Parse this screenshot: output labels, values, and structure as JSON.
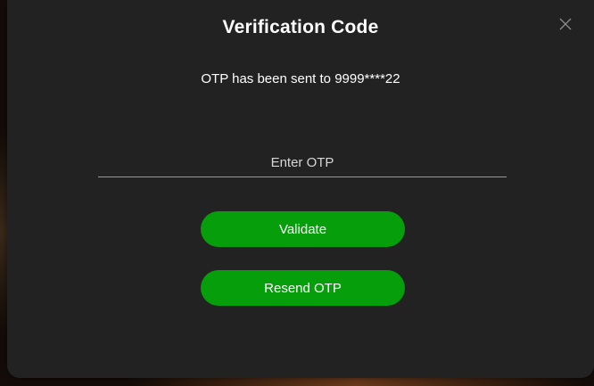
{
  "dialog": {
    "title": "Verification Code",
    "subtitle": "OTP has been sent to 9999****22",
    "close_icon": "close-icon",
    "otp_input": {
      "value": "",
      "placeholder": "Enter OTP"
    },
    "validate_label": "Validate",
    "resend_label": "Resend OTP"
  },
  "colors": {
    "modal_background": "#222222",
    "button_green": "#079e0b",
    "text": "#ffffff"
  }
}
